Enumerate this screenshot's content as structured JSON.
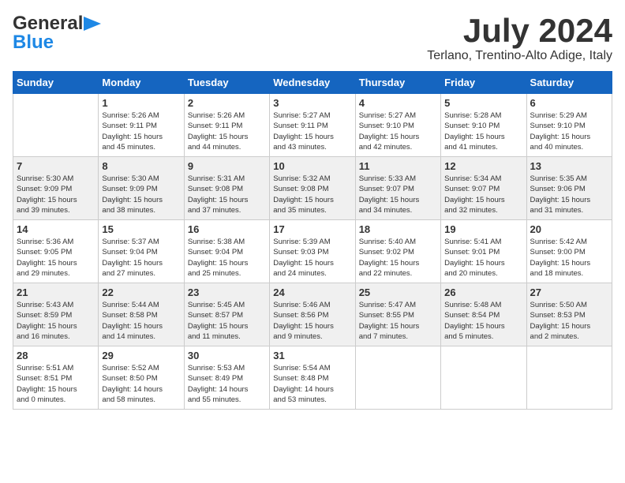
{
  "header": {
    "logo_line1": "General",
    "logo_line2": "Blue",
    "month_year": "July 2024",
    "location": "Terlano, Trentino-Alto Adige, Italy"
  },
  "weekdays": [
    "Sunday",
    "Monday",
    "Tuesday",
    "Wednesday",
    "Thursday",
    "Friday",
    "Saturday"
  ],
  "weeks": [
    [
      {
        "day": "",
        "info": ""
      },
      {
        "day": "1",
        "info": "Sunrise: 5:26 AM\nSunset: 9:11 PM\nDaylight: 15 hours\nand 45 minutes."
      },
      {
        "day": "2",
        "info": "Sunrise: 5:26 AM\nSunset: 9:11 PM\nDaylight: 15 hours\nand 44 minutes."
      },
      {
        "day": "3",
        "info": "Sunrise: 5:27 AM\nSunset: 9:11 PM\nDaylight: 15 hours\nand 43 minutes."
      },
      {
        "day": "4",
        "info": "Sunrise: 5:27 AM\nSunset: 9:10 PM\nDaylight: 15 hours\nand 42 minutes."
      },
      {
        "day": "5",
        "info": "Sunrise: 5:28 AM\nSunset: 9:10 PM\nDaylight: 15 hours\nand 41 minutes."
      },
      {
        "day": "6",
        "info": "Sunrise: 5:29 AM\nSunset: 9:10 PM\nDaylight: 15 hours\nand 40 minutes."
      }
    ],
    [
      {
        "day": "7",
        "info": "Sunrise: 5:30 AM\nSunset: 9:09 PM\nDaylight: 15 hours\nand 39 minutes."
      },
      {
        "day": "8",
        "info": "Sunrise: 5:30 AM\nSunset: 9:09 PM\nDaylight: 15 hours\nand 38 minutes."
      },
      {
        "day": "9",
        "info": "Sunrise: 5:31 AM\nSunset: 9:08 PM\nDaylight: 15 hours\nand 37 minutes."
      },
      {
        "day": "10",
        "info": "Sunrise: 5:32 AM\nSunset: 9:08 PM\nDaylight: 15 hours\nand 35 minutes."
      },
      {
        "day": "11",
        "info": "Sunrise: 5:33 AM\nSunset: 9:07 PM\nDaylight: 15 hours\nand 34 minutes."
      },
      {
        "day": "12",
        "info": "Sunrise: 5:34 AM\nSunset: 9:07 PM\nDaylight: 15 hours\nand 32 minutes."
      },
      {
        "day": "13",
        "info": "Sunrise: 5:35 AM\nSunset: 9:06 PM\nDaylight: 15 hours\nand 31 minutes."
      }
    ],
    [
      {
        "day": "14",
        "info": "Sunrise: 5:36 AM\nSunset: 9:05 PM\nDaylight: 15 hours\nand 29 minutes."
      },
      {
        "day": "15",
        "info": "Sunrise: 5:37 AM\nSunset: 9:04 PM\nDaylight: 15 hours\nand 27 minutes."
      },
      {
        "day": "16",
        "info": "Sunrise: 5:38 AM\nSunset: 9:04 PM\nDaylight: 15 hours\nand 25 minutes."
      },
      {
        "day": "17",
        "info": "Sunrise: 5:39 AM\nSunset: 9:03 PM\nDaylight: 15 hours\nand 24 minutes."
      },
      {
        "day": "18",
        "info": "Sunrise: 5:40 AM\nSunset: 9:02 PM\nDaylight: 15 hours\nand 22 minutes."
      },
      {
        "day": "19",
        "info": "Sunrise: 5:41 AM\nSunset: 9:01 PM\nDaylight: 15 hours\nand 20 minutes."
      },
      {
        "day": "20",
        "info": "Sunrise: 5:42 AM\nSunset: 9:00 PM\nDaylight: 15 hours\nand 18 minutes."
      }
    ],
    [
      {
        "day": "21",
        "info": "Sunrise: 5:43 AM\nSunset: 8:59 PM\nDaylight: 15 hours\nand 16 minutes."
      },
      {
        "day": "22",
        "info": "Sunrise: 5:44 AM\nSunset: 8:58 PM\nDaylight: 15 hours\nand 14 minutes."
      },
      {
        "day": "23",
        "info": "Sunrise: 5:45 AM\nSunset: 8:57 PM\nDaylight: 15 hours\nand 11 minutes."
      },
      {
        "day": "24",
        "info": "Sunrise: 5:46 AM\nSunset: 8:56 PM\nDaylight: 15 hours\nand 9 minutes."
      },
      {
        "day": "25",
        "info": "Sunrise: 5:47 AM\nSunset: 8:55 PM\nDaylight: 15 hours\nand 7 minutes."
      },
      {
        "day": "26",
        "info": "Sunrise: 5:48 AM\nSunset: 8:54 PM\nDaylight: 15 hours\nand 5 minutes."
      },
      {
        "day": "27",
        "info": "Sunrise: 5:50 AM\nSunset: 8:53 PM\nDaylight: 15 hours\nand 2 minutes."
      }
    ],
    [
      {
        "day": "28",
        "info": "Sunrise: 5:51 AM\nSunset: 8:51 PM\nDaylight: 15 hours\nand 0 minutes."
      },
      {
        "day": "29",
        "info": "Sunrise: 5:52 AM\nSunset: 8:50 PM\nDaylight: 14 hours\nand 58 minutes."
      },
      {
        "day": "30",
        "info": "Sunrise: 5:53 AM\nSunset: 8:49 PM\nDaylight: 14 hours\nand 55 minutes."
      },
      {
        "day": "31",
        "info": "Sunrise: 5:54 AM\nSunset: 8:48 PM\nDaylight: 14 hours\nand 53 minutes."
      },
      {
        "day": "",
        "info": ""
      },
      {
        "day": "",
        "info": ""
      },
      {
        "day": "",
        "info": ""
      }
    ]
  ]
}
